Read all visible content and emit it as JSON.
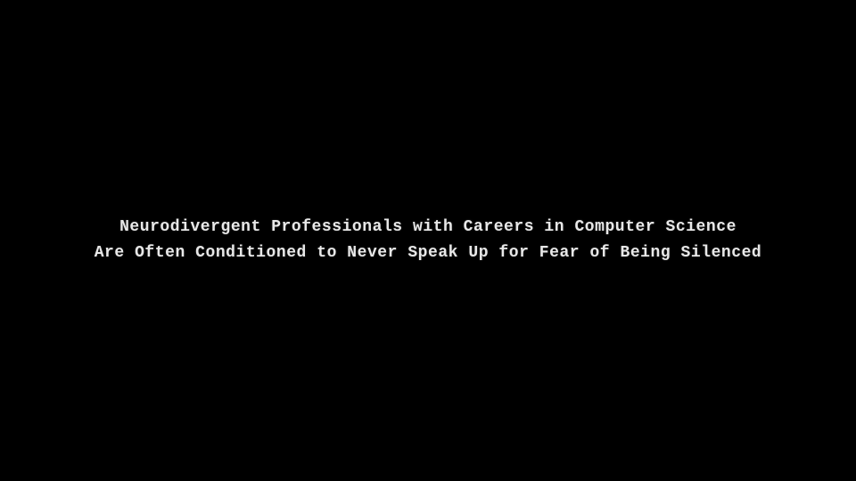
{
  "screen": {
    "background": "#000000"
  },
  "caption": {
    "line1": "Neurodivergent Professionals with Careers in Computer Science",
    "line2": "Are Often Conditioned to Never Speak Up for Fear of Being Silenced"
  }
}
